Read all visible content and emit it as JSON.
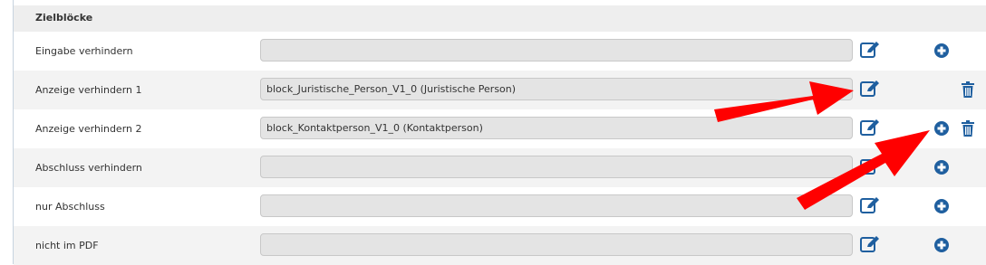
{
  "section": {
    "title": "Zielblöcke"
  },
  "rows": [
    {
      "label": "Eingabe verhindern",
      "value": "",
      "icons": [
        "edit",
        "plus"
      ]
    },
    {
      "label": "Anzeige verhindern 1",
      "value": "block_Juristische_Person_V1_0 (Juristische Person)",
      "icons": [
        "edit",
        "trash"
      ]
    },
    {
      "label": "Anzeige verhindern 2",
      "value": "block_Kontaktperson_V1_0 (Kontaktperson)",
      "icons": [
        "edit",
        "plus",
        "trash"
      ]
    },
    {
      "label": "Abschluss verhindern",
      "value": "",
      "icons": [
        "edit",
        "plus"
      ]
    },
    {
      "label": "nur Abschluss",
      "value": "",
      "icons": [
        "edit",
        "plus"
      ]
    },
    {
      "label": "nicht im PDF",
      "value": "",
      "icons": [
        "edit",
        "plus"
      ]
    }
  ],
  "colors": {
    "icon_blue": "#1f5f9f",
    "arrow_red": "#ff0000",
    "row_alt": "#f3f3f3",
    "header_bg": "#eeeeee",
    "field_bg": "#e4e4e4"
  },
  "icon_names": [
    "edit-icon",
    "plus-circle-icon",
    "trash-icon"
  ]
}
